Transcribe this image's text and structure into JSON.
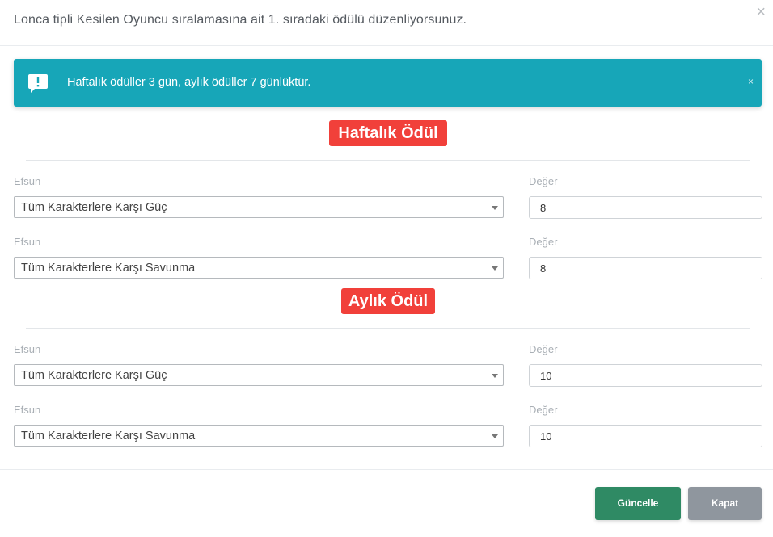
{
  "modal": {
    "title": "Lonca tipli Kesilen Oyuncu sıralamasına ait 1. sıradaki ödülü düzenliyorsunuz.",
    "close_glyph": "×"
  },
  "alert": {
    "text": "Haftalık ödüller 3 gün, aylık ödüller 7 günlüktür.",
    "close_glyph": "×",
    "color": "#17a6b8"
  },
  "weekly": {
    "heading": "Haftalık Ödül",
    "rows": [
      {
        "enchant_label": "Efsun",
        "enchant_value": "Tüm Karakterlere Karşı Güç",
        "value_label": "Değer",
        "value": "8"
      },
      {
        "enchant_label": "Efsun",
        "enchant_value": "Tüm Karakterlere Karşı Savunma",
        "value_label": "Değer",
        "value": "8"
      }
    ]
  },
  "monthly": {
    "heading": "Aylık Ödül",
    "rows": [
      {
        "enchant_label": "Efsun",
        "enchant_value": "Tüm Karakterlere Karşı Güç",
        "value_label": "Değer",
        "value": "10"
      },
      {
        "enchant_label": "Efsun",
        "enchant_value": "Tüm Karakterlere Karşı Savunma",
        "value_label": "Değer",
        "value": "10"
      }
    ]
  },
  "footer": {
    "update_label": "Güncelle",
    "close_label": "Kapat"
  },
  "colors": {
    "badge": "#f1403a",
    "update_button": "#2f8a64",
    "close_button": "#8f969e"
  }
}
